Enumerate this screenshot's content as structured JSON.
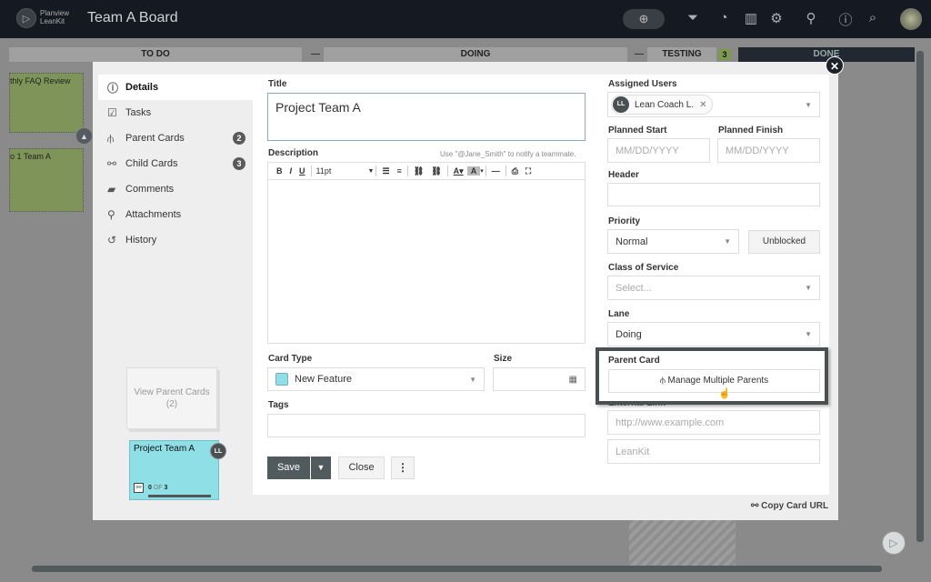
{
  "topbar": {
    "logo_line1": "Planview",
    "logo_line2": "LeanKit",
    "board_title": "Team A Board",
    "icons": [
      "add-card-icon",
      "filter-icon",
      "activity-icon",
      "analytics-icon",
      "settings-icon",
      "add-user-icon",
      "info-icon",
      "search-icon",
      "user-avatar"
    ]
  },
  "board": {
    "lanes": [
      {
        "name": "TO DO"
      },
      {
        "name": "DOING"
      },
      {
        "name": "TESTING",
        "count": "3"
      },
      {
        "name": "DONE"
      }
    ],
    "background_cards": [
      {
        "title": "thly FAQ Review",
        "color": "#7f9459"
      },
      {
        "title": "o 1 Team A",
        "color": "#7f9459"
      }
    ]
  },
  "modal": {
    "nav": [
      {
        "label": "Details",
        "icon": "info-icon",
        "active": true
      },
      {
        "label": "Tasks",
        "icon": "checkbox-icon"
      },
      {
        "label": "Parent Cards",
        "icon": "parent-cards-icon",
        "badge": "2"
      },
      {
        "label": "Child Cards",
        "icon": "child-cards-icon",
        "badge": "3"
      },
      {
        "label": "Comments",
        "icon": "comments-icon"
      },
      {
        "label": "Attachments",
        "icon": "paperclip-icon"
      },
      {
        "label": "History",
        "icon": "history-icon"
      }
    ],
    "view_parent_cards": {
      "label": "View Parent Cards",
      "count": "(2)"
    },
    "preview_card": {
      "title": "Project Team A",
      "avatar": "LL",
      "progress_done": "0",
      "progress_of": "OF",
      "progress_total": "3",
      "color": "#8fdfe6"
    },
    "title_label": "Title",
    "title_value": "Project Team A",
    "description_label": "Description",
    "description_hint": "Use \"@Jane_Smith\" to notify a teammate.",
    "editor_toolbar": {
      "bold": "B",
      "italic": "I",
      "underline": "U",
      "font_size": "11pt"
    },
    "card_type_label": "Card Type",
    "card_type_value": "New Feature",
    "size_label": "Size",
    "tags_label": "Tags",
    "save_label": "Save",
    "close_label": "Close",
    "assigned_users_label": "Assigned Users",
    "assigned_user": {
      "initials": "LL",
      "name": "Lean Coach L."
    },
    "planned_start_label": "Planned Start",
    "planned_start_placeholder": "MM/DD/YYYY",
    "planned_finish_label": "Planned Finish",
    "planned_finish_placeholder": "MM/DD/YYYY",
    "header_label": "Header",
    "priority_label": "Priority",
    "priority_value": "Normal",
    "blocked_label": "Unblocked",
    "class_of_service_label": "Class of Service",
    "class_of_service_placeholder": "Select...",
    "lane_label": "Lane",
    "lane_value": "Doing",
    "parent_card_label": "Parent Card",
    "manage_parents_label": "Manage Multiple Parents",
    "external_link_label": "External Link",
    "external_link_placeholder": "http://www.example.com",
    "external_link_title_placeholder": "LeanKit",
    "copy_url_label": "Copy Card URL"
  }
}
